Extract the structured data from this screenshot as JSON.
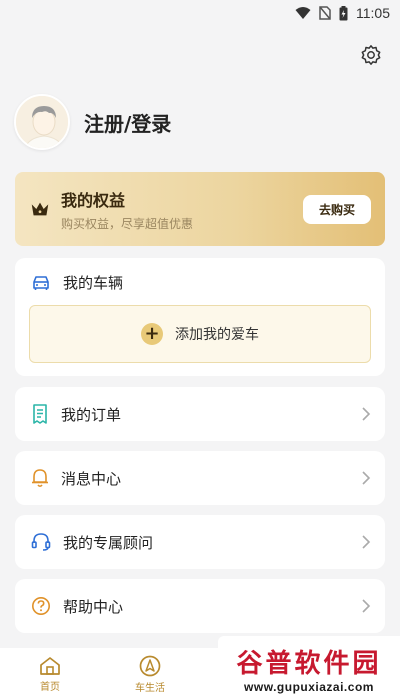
{
  "status": {
    "time": "11:05"
  },
  "profile": {
    "login_text": "注册/登录"
  },
  "benefits": {
    "title": "我的权益",
    "subtitle": "购买权益，尽享超值优惠",
    "buy_label": "去购买"
  },
  "vehicle": {
    "title": "我的车辆",
    "add_label": "添加我的爱车"
  },
  "menu": {
    "orders": "我的订单",
    "messages": "消息中心",
    "advisor": "我的专属顾问",
    "help": "帮助中心"
  },
  "nav": {
    "home": "首页",
    "car_life": "车生活"
  },
  "watermark": {
    "title": "谷普软件园",
    "url": "www.gupuxiazai.com"
  },
  "colors": {
    "accent": "#b88a2e",
    "gold": "#e8c978",
    "blue_icon": "#2f6fd6"
  }
}
